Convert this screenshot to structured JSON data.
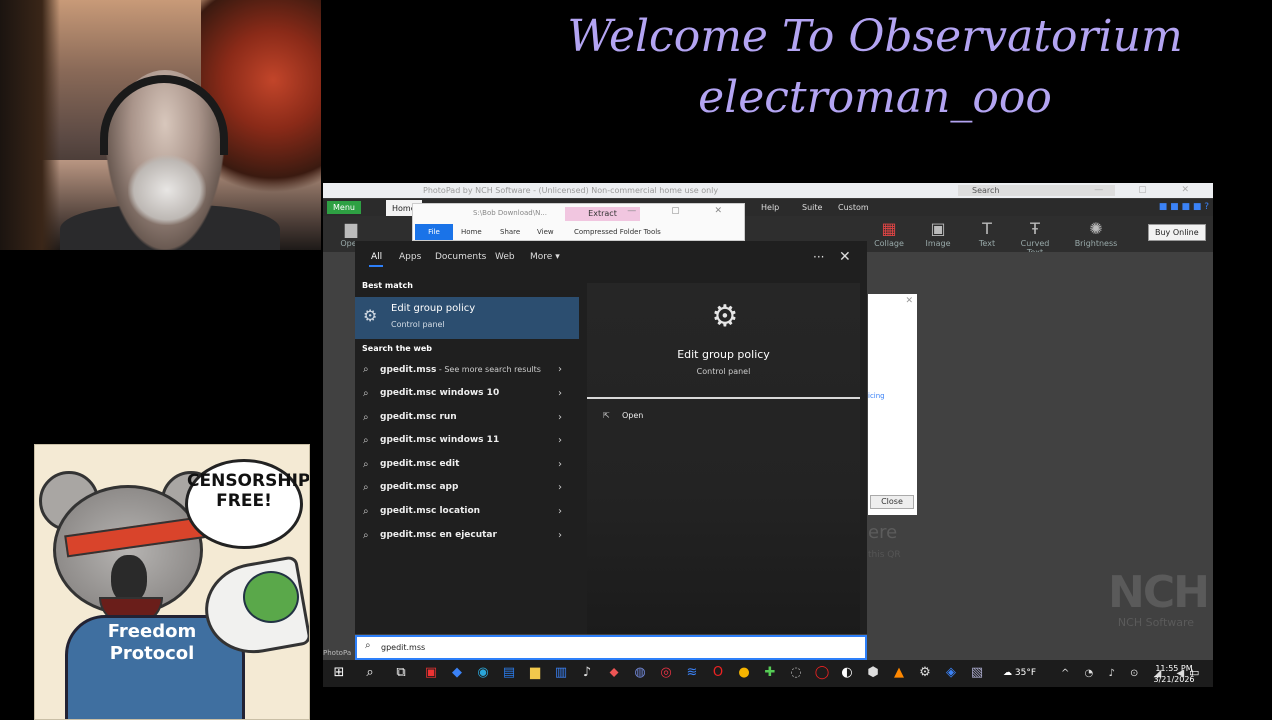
{
  "overlay": {
    "title_line1": "Welcome To Observatorium",
    "title_line2": "electroman_ooo"
  },
  "poster": {
    "bubble": "CENSORSHIP FREE!",
    "hoodie": "Freedom Protocol"
  },
  "photopad": {
    "title": "PhotoPad by NCH Software - (Unlicensed) Non-commercial home use only",
    "search_placeholder": "Search",
    "menu_label": "Menu",
    "home_tab": "Home",
    "help_tab": "Help",
    "suite_tab": "Suite",
    "custom_tab": "Custom",
    "tools": [
      "Open",
      "Collage",
      "Image",
      "Text",
      "Curved Text",
      "Brightness"
    ],
    "buy_online": "Buy Online",
    "dialog_close": "Close",
    "dialog_link": "icing",
    "behind_text": "ere",
    "behind_sub": "this QR",
    "nch_logo": "NCH",
    "nch_sub": "NCH Software",
    "status_text": "PhotoPa"
  },
  "explorer": {
    "path": "S:\\Bob Download\\N...",
    "extract": "Extract",
    "tabs": [
      "File",
      "Home",
      "Share",
      "View",
      "Compressed Folder Tools"
    ]
  },
  "search_panel": {
    "tabs": [
      "All",
      "Apps",
      "Documents",
      "Web",
      "More"
    ],
    "best_match_heading": "Best match",
    "best_match": {
      "title": "Edit group policy",
      "subtitle": "Control panel"
    },
    "search_web_heading": "Search the web",
    "web_results": [
      {
        "term": "gpedit.mss",
        "extra": " - See more search results"
      },
      {
        "term": "gpedit.msc windows 10",
        "extra": ""
      },
      {
        "term": "gpedit.msc run",
        "extra": ""
      },
      {
        "term": "gpedit.msc windows 11",
        "extra": ""
      },
      {
        "term": "gpedit.msc edit",
        "extra": ""
      },
      {
        "term": "gpedit.msc app",
        "extra": ""
      },
      {
        "term": "gpedit.msc location",
        "extra": ""
      },
      {
        "term": "gpedit.msc en ejecutar",
        "extra": ""
      }
    ],
    "detail": {
      "name": "Edit group policy",
      "subtitle": "Control panel",
      "open_label": "Open"
    },
    "query": "gpedit.mss"
  },
  "taskbar": {
    "weather": "35°F",
    "time": "11:55 PM",
    "date": "3/21/2026"
  },
  "colors": {
    "title_text": "#b3a4f2",
    "best_match_bg": "#2c4e70",
    "accent": "#2d7ff9"
  },
  "icons": [
    "windows-start-icon",
    "search-icon",
    "task-view-icon",
    "gear-icon",
    "chevron-right-icon",
    "close-icon",
    "open-icon"
  ]
}
